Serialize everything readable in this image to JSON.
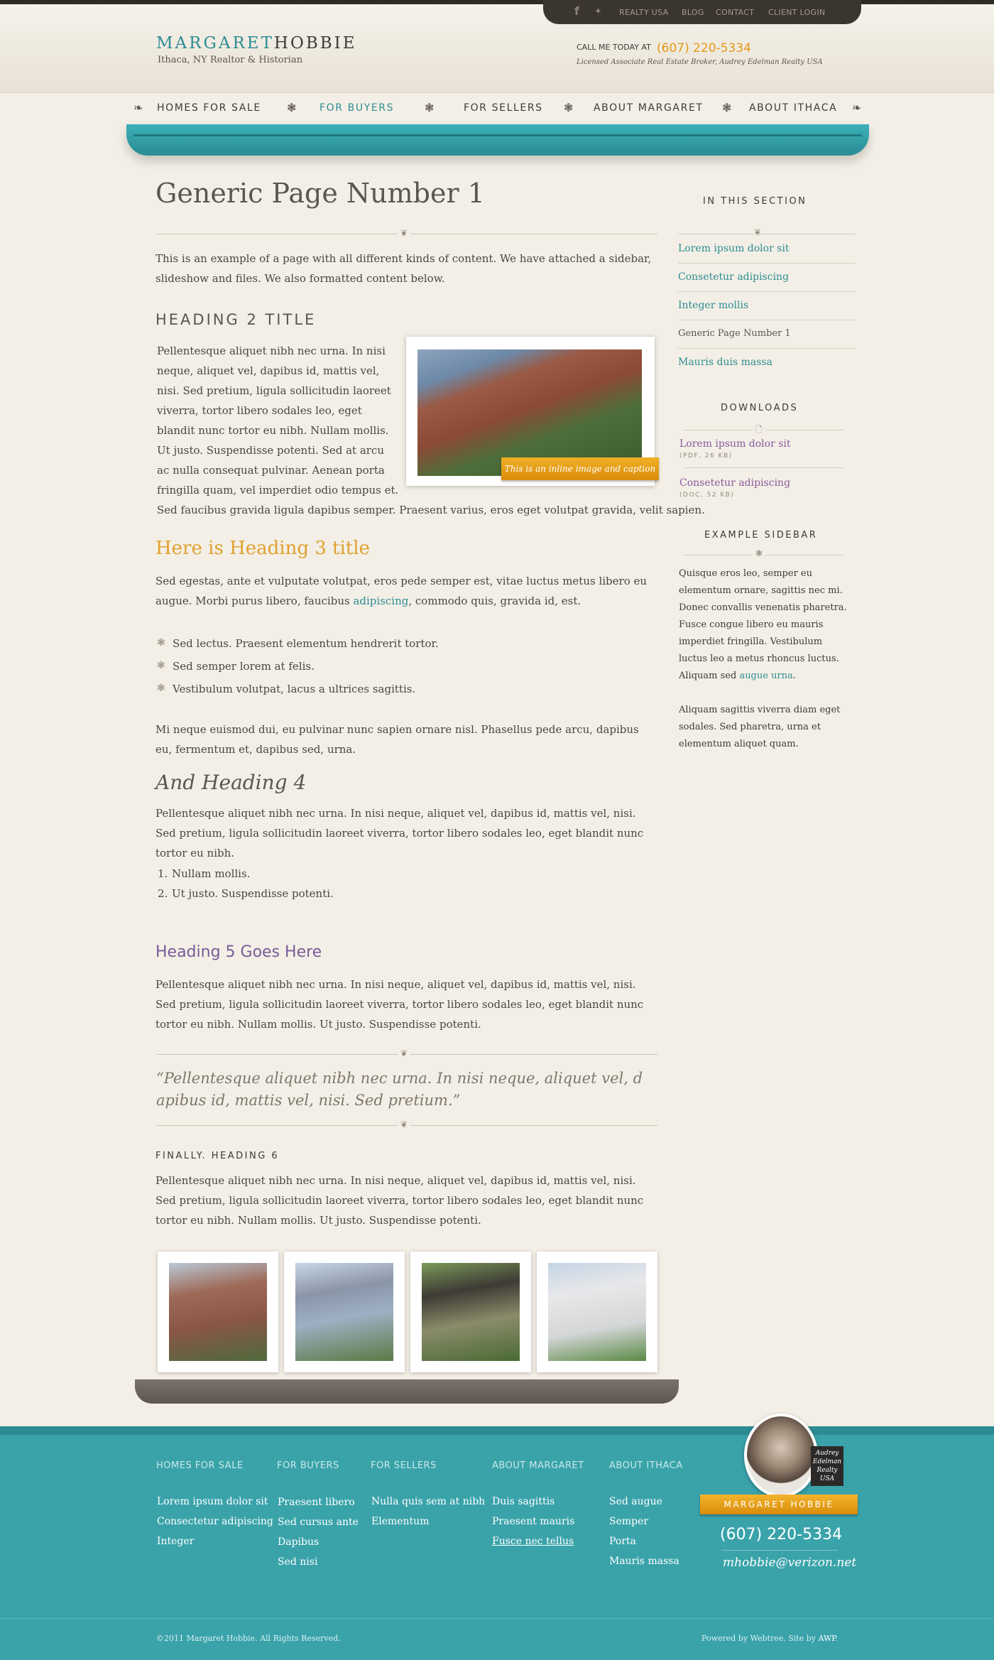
{
  "utility_nav": {
    "social": [
      "facebook-icon",
      "twitter-icon"
    ],
    "links": [
      "REALTY USA",
      "BLOG",
      "CONTACT",
      "CLIENT LOGIN"
    ]
  },
  "brand": {
    "name_first": "MARGARET",
    "name_last": "HOBBIE",
    "tagline": "Ithaca, NY Realtor & Historian",
    "call_label": "CALL ME TODAY AT",
    "phone": "(607) 220-5334",
    "license": "Licensed Associate Real Estate Broker, Audrey Edelman Realty USA"
  },
  "nav": {
    "items": [
      "HOMES FOR SALE",
      "FOR BUYERS",
      "FOR SELLERS",
      "ABOUT MARGARET",
      "ABOUT ITHACA"
    ],
    "active": "FOR BUYERS"
  },
  "main": {
    "title": "Generic Page Number 1",
    "intro": "This is an example of a page with all different kinds of content. We have attached a sidebar, slideshow and files. We also formatted content below.",
    "h2": "HEADING 2 TITLE",
    "h2_para_lines": [
      "Pellentesque aliquet nibh nec urna. In nisi",
      "neque, aliquet vel, dapibus id, mattis vel,",
      "nisi. Sed pretium, ligula sollicitudin laoreet",
      "viverra, tortor libero sodales leo, eget",
      "blandit nunc tortor eu nibh. Nullam mollis.",
      "Ut justo. Suspendisse potenti.  Sed at arcu",
      "ac nulla consequat pulvinar. Aenean porta",
      "fringilla quam, vel imperdiet odio tempus et."
    ],
    "h2_para_last": "Sed faucibus gravida ligula dapibus semper. Praesent varius, eros eget volutpat gravida, velit sapien.",
    "image_caption": "This is an inline image and caption",
    "h3": "Here is Heading 3 title",
    "h3_para_a": "Sed egestas, ante et vulputate volutpat, eros pede semper est, vitae luctus metus libero eu augue. Morbi purus libero, faucibus ",
    "h3_para_link": "adipiscing",
    "h3_para_b": ", commodo quis, gravida id, est.",
    "bullets": [
      "Sed lectus. Praesent elementum hendrerit tortor.",
      "Sed semper lorem at felis.",
      "Vestibulum volutpat, lacus a ultrices sagittis."
    ],
    "para_after_bullets": "Mi neque euismod dui, eu pulvinar nunc sapien ornare nisl. Phasellus pede arcu, dapibus eu, fermentum et, dapibus sed, urna.",
    "h4": "And Heading 4",
    "h4_para": "Pellentesque aliquet nibh nec urna. In nisi neque, aliquet vel, dapibus id, mattis vel, nisi. Sed pretium, ligula sollicitudin laoreet viverra, tortor libero sodales leo, eget blandit nunc tortor eu nibh.",
    "ordered": [
      "Nullam mollis.",
      "Ut justo. Suspendisse potenti."
    ],
    "h5": "Heading 5 Goes Here",
    "h5_para": "Pellentesque aliquet nibh nec urna. In nisi neque, aliquet vel, dapibus id, mattis vel, nisi. Sed pretium, ligula sollicitudin laoreet viverra, tortor libero sodales leo, eget blandit nunc tortor eu nibh. Nullam mollis. Ut justo. Suspendisse potenti.",
    "quote": "“Pellentesque aliquet nibh nec urna. In nisi neque, aliquet vel, d apibus id, mattis vel, nisi. Sed pretium.”",
    "h6": "FINALLY. HEADING 6",
    "h6_para": "Pellentesque aliquet nibh nec urna. In nisi neque, aliquet vel, dapibus id, mattis vel, nisi. Sed pretium, ligula sollicitudin laoreet viverra, tortor libero sodales leo, eget blandit nunc tortor eu nibh. Nullam mollis. Ut justo. Suspendisse potenti."
  },
  "sidebar": {
    "section_title": "IN THIS SECTION",
    "section_items": [
      "Lorem ipsum dolor sit",
      "Consetetur adipiscing",
      "Integer mollis",
      "Generic Page Number 1",
      "Mauris duis massa"
    ],
    "current_item": "Generic Page Number 1",
    "downloads_title": "DOWNLOADS",
    "downloads": [
      {
        "name": "Lorem ipsum dolor sit",
        "meta": "(PDF, 26 KB)"
      },
      {
        "name": "Consetetur adipiscing",
        "meta": "(DOC, 52 KB)"
      }
    ],
    "example_title": "EXAMPLE SIDEBAR",
    "example_text_a": "Quisque eros leo, semper eu elementum ornare, sagittis nec mi. Donec convallis venenatis pharetra. Fusce congue libero eu mauris imperdiet fringilla. Vestibulum luctus leo a metus rhoncus luctus. Aliquam sed ",
    "example_link": "augue urna",
    "example_text_b": ".",
    "example_text_2": "Aliquam sagittis viverra diam eget sodales. Sed pharetra, urna et elementum aliquet quam."
  },
  "footer": {
    "columns": [
      {
        "title": "HOMES FOR SALE",
        "links": [
          "Lorem ipsum dolor sit",
          "Consectetur adipiscing",
          "Integer"
        ]
      },
      {
        "title": "FOR BUYERS",
        "links": [
          "Praesent libero",
          "Sed cursus ante",
          "Dapibus",
          "Sed nisi"
        ]
      },
      {
        "title": "FOR SELLERS",
        "links": [
          "Nulla quis sem at nibh",
          "Elementum"
        ]
      },
      {
        "title": "ABOUT MARGARET",
        "links": [
          "Duis sagittis",
          "Praesent mauris",
          "Fusce nec tellus"
        ]
      },
      {
        "title": "ABOUT ITHACA",
        "links": [
          "Sed augue",
          "Semper",
          "Porta",
          "Mauris massa"
        ]
      }
    ],
    "badge_text": "Audrey Edelman Realty USA",
    "ribbon_name": "MARGARET HOBBIE",
    "phone": "(607) 220-5334",
    "email": "mhobbie@verizon.net",
    "copyright": "©2011 Margaret Hobbie.  All Rights Reserved.",
    "powered_a": "Powered by ",
    "powered_b": "Webtree",
    "powered_c": ".   Site by ",
    "powered_d": "AWP",
    "powered_e": "."
  },
  "colors": {
    "accent": "#2d8c93",
    "orange": "#e39a16",
    "purple": "#7a5a9a",
    "footer": "#3aa3aa"
  }
}
